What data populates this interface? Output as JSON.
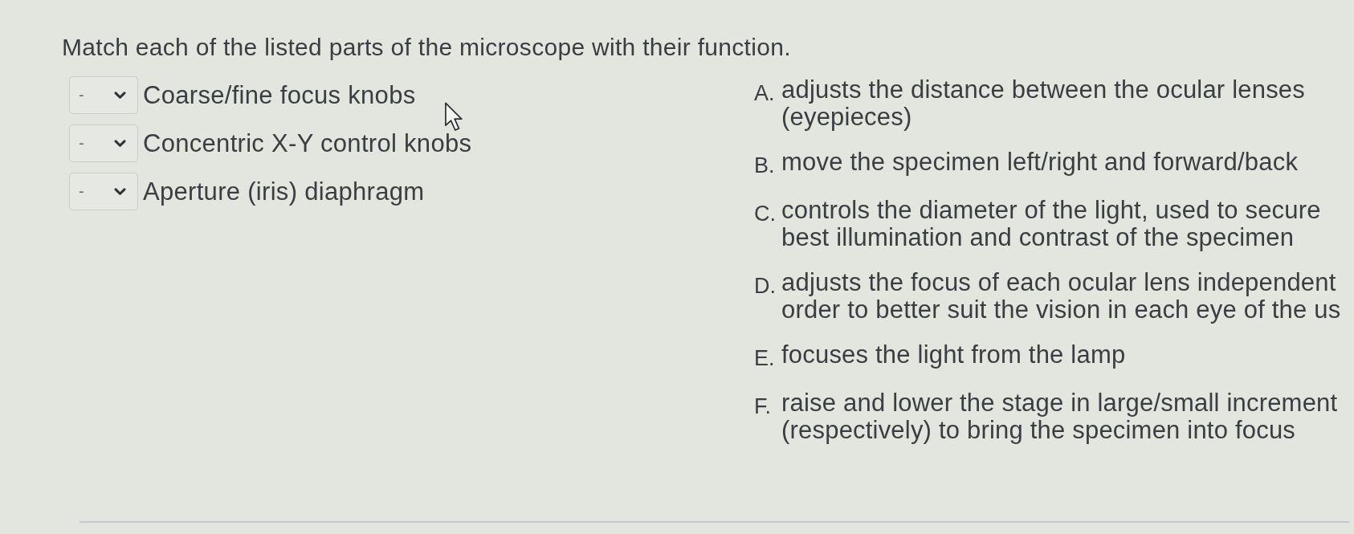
{
  "question": {
    "prompt": "Match each of the listed parts of the microscope with their function."
  },
  "parts": [
    {
      "selection": "-",
      "label": "Coarse/fine focus knobs"
    },
    {
      "selection": "-",
      "label": "Concentric X-Y control knobs"
    },
    {
      "selection": "-",
      "label": "Aperture (iris) diaphragm"
    }
  ],
  "functions": [
    {
      "letter": "A.",
      "lines": [
        "adjusts the distance between the ocular lenses",
        "(eyepieces)"
      ]
    },
    {
      "letter": "B.",
      "lines": [
        "move the specimen left/right and forward/back"
      ]
    },
    {
      "letter": "C.",
      "lines": [
        "controls the diameter of the light, used to secure",
        "best illumination and contrast of the specimen"
      ]
    },
    {
      "letter": "D.",
      "lines": [
        "adjusts the focus of each ocular lens independent",
        "order to better suit the vision in each eye of the us"
      ]
    },
    {
      "letter": "E.",
      "lines": [
        "focuses the light from the lamp"
      ]
    },
    {
      "letter": "F.",
      "lines": [
        "raise and lower the stage in large/small increment",
        "(respectively) to bring the specimen into focus"
      ]
    }
  ]
}
